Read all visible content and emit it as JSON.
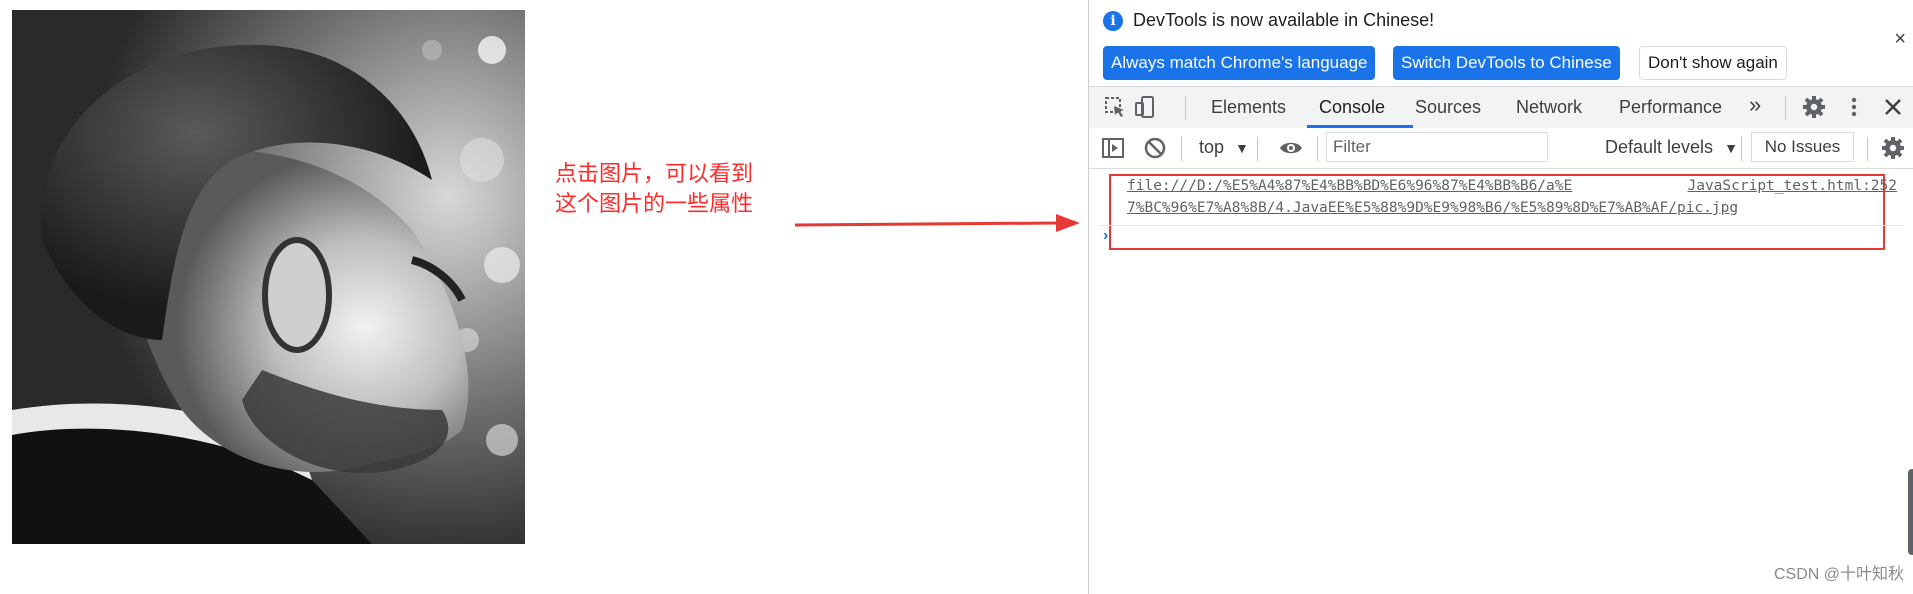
{
  "annotation": {
    "line1": "点击图片，可以看到",
    "line2": "这个图片的一些属性"
  },
  "devtools": {
    "infobar": {
      "message": "DevTools is now available in Chinese!",
      "btn_match": "Always match Chrome's language",
      "btn_switch": "Switch DevTools to Chinese",
      "btn_dont_show": "Don't show again",
      "close": "×"
    },
    "tabs": {
      "elements": "Elements",
      "console": "Console",
      "sources": "Sources",
      "network": "Network",
      "performance": "Performance",
      "more": "»"
    },
    "console_toolbar": {
      "context": "top",
      "filter_placeholder": "Filter",
      "levels": "Default levels",
      "issues": "No Issues"
    },
    "log": {
      "url_part1": "file:///D:/%E5%A4%87%E4%BB%BD%E6%96%87%E4%BB%B6/a%E",
      "url_part2": "7%BC%96%E7%A8%8B/4.JavaEE%E5%88%9D%E9%98%B6/%E5%89%8D%E7%AB%AF/pic.jpg",
      "source": "JavaScript_test.html:252"
    },
    "prompt": "›"
  },
  "watermark": "CSDN @十叶知秋",
  "colors": {
    "accent": "#1a73e8",
    "annotation": "#ff2b2b",
    "highlight_box": "#e53935"
  }
}
